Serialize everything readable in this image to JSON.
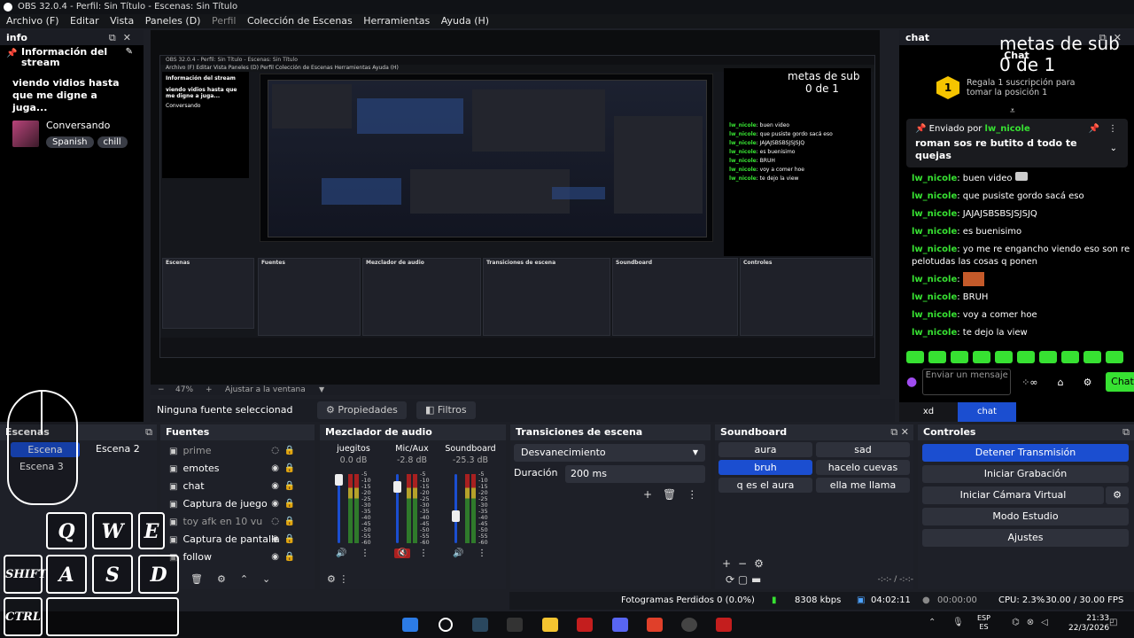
{
  "window": {
    "title": "OBS 32.0.4 - Perfil: Sin Título - Escenas: Sin Título"
  },
  "menu": [
    "Archivo (F)",
    "Editar",
    "Vista",
    "Paneles (D)",
    "Perfil",
    "Colección de Escenas",
    "Herramientas",
    "Ayuda (H)"
  ],
  "info_dock": {
    "title": "info",
    "section": "Información del stream",
    "stream_title": "viendo vidios hasta que me digne a juga...",
    "category": "Conversando",
    "tags": [
      "Spanish",
      "chill"
    ]
  },
  "preview": {
    "zoom": "47%",
    "fit": "Ajustar a la ventana",
    "no_source": "Ninguna fuente seleccionad",
    "properties": "Propiedades",
    "filters": "Filtros"
  },
  "nested": {
    "title": "OBS 32.0.4 - Perfil: Sin Título - Escenas: Sin Título",
    "menu": "Archivo (F)   Editar   Vista   Paneles (D)   Perfil   Colección de Escenas   Herramientas   Ayuda (H)"
  },
  "chat_dock": {
    "title": "chat",
    "goal_line1": "metas de sub",
    "goal_line2": "0 de 1",
    "chat_label": "Chat",
    "sub_rank": "1",
    "sub_text": "Regala 1 suscripción para tomar la posición 1",
    "pinned_by": "Enviado por",
    "pinned_user": "lw_nicole",
    "pinned_text": "roman sos re butito d todo te quejas",
    "messages": [
      {
        "user": "lw_nicole",
        "text": "buen video"
      },
      {
        "user": "lw_nicole",
        "text": "que pusiste gordo sacá eso"
      },
      {
        "user": "lw_nicole",
        "text": "JAJAJSBSBSJSJSJQ"
      },
      {
        "user": "lw_nicole",
        "text": "es buenisimo"
      },
      {
        "user": "lw_nicole",
        "text": "yo me re engancho viendo eso son re pelotudas las cosas q ponen"
      },
      {
        "user": "lw_nicole",
        "text": ""
      },
      {
        "user": "lw_nicole",
        "text": "BRUH"
      },
      {
        "user": "lw_nicole",
        "text": "voy a comer hoe"
      },
      {
        "user": "lw_nicole",
        "text": "te dejo la view"
      }
    ],
    "input_placeholder": "Enviar un mensaje",
    "send": "Chat",
    "tabs": [
      "xd",
      "chat"
    ]
  },
  "scenes": {
    "title": "Escenas",
    "items": [
      "Escena",
      "Escena 2",
      "Escena 3"
    ]
  },
  "sources": {
    "title": "Fuentes",
    "items": [
      {
        "name": "prime",
        "icon": "image-icon",
        "visible": false
      },
      {
        "name": "emotes",
        "icon": "browser-icon",
        "visible": true
      },
      {
        "name": "chat",
        "icon": "browser-icon",
        "visible": true
      },
      {
        "name": "Captura de juego",
        "icon": "gamepad-icon",
        "visible": true
      },
      {
        "name": "toy afk en 10 vu",
        "icon": "text-icon",
        "visible": false
      },
      {
        "name": "Captura de pantalla",
        "icon": "monitor-icon",
        "visible": true
      },
      {
        "name": "follow",
        "icon": "browser-icon",
        "visible": true
      }
    ]
  },
  "mixer": {
    "title": "Mezclador de audio",
    "channels": [
      {
        "name": "juegitos",
        "db": "0.0 dB",
        "level": 1.0,
        "muted": false
      },
      {
        "name": "Mic/Aux",
        "db": "-2.8 dB",
        "level": 0.88,
        "muted": true
      },
      {
        "name": "Soundboard",
        "db": "-25.3 dB",
        "level": 0.42,
        "muted": false
      }
    ],
    "scale": [
      "-5",
      "-10",
      "-15",
      "-20",
      "-25",
      "-30",
      "-35",
      "-40",
      "-45",
      "-50",
      "-55",
      "-60"
    ]
  },
  "transitions": {
    "title": "Transiciones de escena",
    "selected": "Desvanecimiento",
    "duration_label": "Duración",
    "duration": "200 ms"
  },
  "soundboard": {
    "title": "Soundboard",
    "buttons": [
      "aura",
      "sad",
      "bruh",
      "hacelo cuevas",
      "q es el aura",
      "ella me llama"
    ],
    "time": "-:-:- / -:-:-"
  },
  "controls": {
    "title": "Controles",
    "buttons": [
      "Detener Transmisión",
      "Iniciar Grabación",
      "Iniciar Cámara Virtual",
      "Modo Estudio",
      "Ajustes"
    ]
  },
  "status": {
    "dropped": "Fotogramas Perdidos 0 (0.0%)",
    "bitrate": "8308 kbps",
    "live_time": "04:02:11",
    "rec_time": "00:00:00",
    "cpu": "CPU: 2.3%",
    "fps": "30.00 / 30.00 FPS"
  },
  "taskbar": {
    "lang1": "ESP",
    "lang2": "ES",
    "time": "21:33",
    "date": "22/3/2026"
  },
  "keyboard_overlay": {
    "keys": [
      "Q",
      "W",
      "E",
      "SHIFT",
      "A",
      "S",
      "D",
      "CTRL"
    ]
  },
  "colors": {
    "accent": "#1b4ed0",
    "chat_green": "#37e132",
    "panel": "#1e2028"
  }
}
